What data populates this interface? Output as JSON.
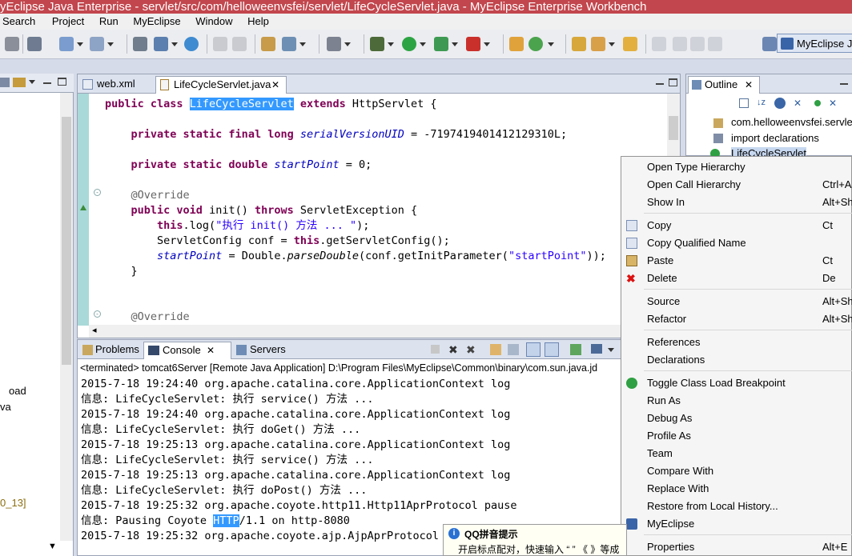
{
  "window": {
    "title": "yEclipse Java Enterprise - servlet/src/com/helloweenvsfei/servlet/LifeCycleServlet.java - MyEclipse Enterprise Workbench"
  },
  "menu": {
    "items": [
      "Search",
      "Project",
      "Run",
      "MyEclipse",
      "Window",
      "Help"
    ]
  },
  "perspective": {
    "label": "MyEclipse J"
  },
  "left_pane": {
    "items": [
      "oad",
      "va",
      "0_13]"
    ]
  },
  "editor": {
    "tabs": [
      {
        "label": "web.xml",
        "active": false
      },
      {
        "label": "LifeCycleServlet.java",
        "active": true
      }
    ],
    "code": {
      "l1_kw": "public class ",
      "l1_cls": "LifeCycleServlet",
      "l1_kw2": " extends ",
      "l1_rest": "HttpServlet {",
      "l2_kw": "private static final long ",
      "l2_fld": "serialVersionUID",
      "l2_rest": " = -7197419401412129310L;",
      "l3_kw": "private static double ",
      "l3_fld": "startPoint",
      "l3_rest": " = 0;",
      "l4_ann": "@Override",
      "l5_kw": "public void ",
      "l5_mid": "init() ",
      "l5_kw2": "throws ",
      "l5_rest": "ServletException {",
      "l6_kw": "this",
      "l6_mid": ".log(",
      "l6_str": "\"执行 init() 方法 ... \"",
      "l6_rest": ");",
      "l7_a": "ServletConfig conf = ",
      "l7_kw": "this",
      "l7_rest": ".getServletConfig();",
      "l8_fld": "startPoint",
      "l8_mid": " = Double.",
      "l8_it": "parseDouble",
      "l8_mid2": "(conf.getInitParameter(",
      "l8_str": "\"startPoint\"",
      "l8_rest": "));",
      "l9": "}",
      "l10_ann": "@Override"
    }
  },
  "console": {
    "tabs": [
      {
        "label": "Problems",
        "active": false
      },
      {
        "label": "Console",
        "active": true
      },
      {
        "label": "Servers",
        "active": false
      }
    ],
    "status": "<terminated> tomcat6Server [Remote Java Application] D:\\Program Files\\MyEclipse\\Common\\binary\\com.sun.java.jd",
    "lines": [
      "2015-7-18 19:24:40 org.apache.catalina.core.ApplicationContext log",
      "信息: LifeCycleServlet: 执行 service() 方法 ...",
      "2015-7-18 19:24:40 org.apache.catalina.core.ApplicationContext log",
      "信息: LifeCycleServlet: 执行 doGet() 方法 ...",
      "2015-7-18 19:25:13 org.apache.catalina.core.ApplicationContext log",
      "信息: LifeCycleServlet: 执行 service() 方法 ...",
      "2015-7-18 19:25:13 org.apache.catalina.core.ApplicationContext log",
      "信息: LifeCycleServlet: 执行 doPost() 方法 ...",
      "2015-7-18 19:25:32 org.apache.coyote.http11.Http11AprProtocol pause"
    ],
    "line10_a": "信息: Pausing Coyote ",
    "line10_sel": "HTTP",
    "line10_b": "/1.1 on http-8080",
    "line11": "2015-7-18 19:25:32 org.apache.coyote.ajp.AjpAprProtocol p"
  },
  "outline": {
    "tab": "Outline",
    "items": [
      "com.helloweenvsfei.servlet",
      "import declarations",
      "LifeCycleServlet"
    ]
  },
  "context_menu": {
    "groups": [
      [
        {
          "label": "Open Type Hierarchy",
          "accel": ""
        },
        {
          "label": "Open Call Hierarchy",
          "accel": "Ctrl+A"
        },
        {
          "label": "Show In",
          "accel": "Alt+Shif"
        }
      ],
      [
        {
          "label": "Copy",
          "accel": "Ct"
        },
        {
          "label": "Copy Qualified Name",
          "accel": ""
        },
        {
          "label": "Paste",
          "accel": "Ct"
        },
        {
          "label": "Delete",
          "accel": "De"
        }
      ],
      [
        {
          "label": "Source",
          "accel": "Alt+Shi"
        },
        {
          "label": "Refactor",
          "accel": "Alt+Shi"
        }
      ],
      [
        {
          "label": "References",
          "accel": ""
        },
        {
          "label": "Declarations",
          "accel": ""
        }
      ],
      [
        {
          "label": "Toggle Class Load Breakpoint",
          "accel": ""
        },
        {
          "label": "Run As",
          "accel": ""
        },
        {
          "label": "Debug As",
          "accel": ""
        },
        {
          "label": "Profile As",
          "accel": ""
        },
        {
          "label": "Team",
          "accel": ""
        },
        {
          "label": "Compare With",
          "accel": ""
        },
        {
          "label": "Replace With",
          "accel": ""
        },
        {
          "label": "Restore from Local History...",
          "accel": ""
        },
        {
          "label": "MyEclipse",
          "accel": ""
        }
      ],
      [
        {
          "label": "Properties",
          "accel": "Alt+E"
        }
      ]
    ]
  },
  "qq_tip": {
    "title": "QQ拼音提示",
    "body": "开启标点配对，快速输入 “ ” 《 》等成"
  },
  "colors": {
    "titlebar": "#c2464d",
    "selection": "#3399ff",
    "keyword": "#7f0055",
    "field": "#0000c0",
    "string": "#2a00ff"
  }
}
